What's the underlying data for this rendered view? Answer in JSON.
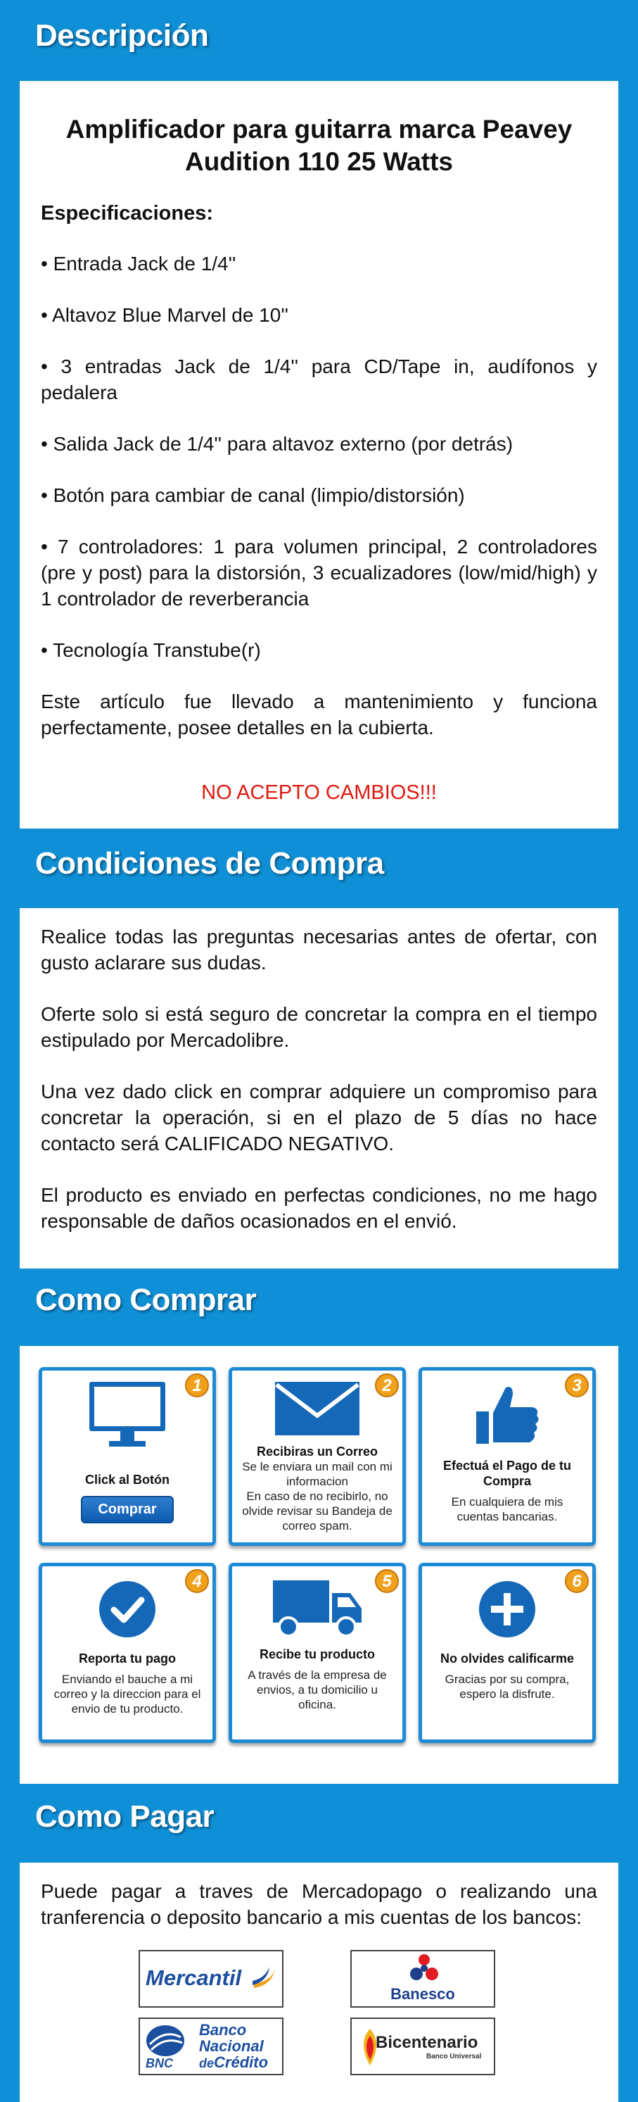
{
  "descripcion": {
    "heading": "Descripción",
    "product_title": "Amplificador para guitarra marca Peavey Audition 110 25 Watts",
    "specs_heading": "Especificaciones:",
    "bullets": [
      "• Entrada Jack de 1/4''",
      "• Altavoz Blue Marvel de 10''",
      "• 3 entradas Jack de 1/4'' para CD/Tape in, audífonos y pedalera",
      "• Salida Jack de 1/4'' para altavoz externo (por detrás)",
      "• Botón para cambiar de canal (limpio/distorsión)",
      "• 7 controladores: 1 para volumen principal, 2 controladores (pre y post) para la distorsión, 3 ecualizadores (low/mid/high) y 1 controlador de reverberancia",
      "• Tecnología Transtube(r)"
    ],
    "note": "Este artículo fue llevado a mantenimiento y funciona perfectamente, posee detalles en la cubierta.",
    "warning": "NO ACEPTO CAMBIOS!!!"
  },
  "condiciones": {
    "heading": "Condiciones de Compra",
    "paragraphs": [
      "Realice todas las preguntas necesarias antes de ofertar, con gusto aclarare sus dudas.",
      "Oferte solo si está seguro de concretar la compra en el tiempo estipulado por Mercadolibre.",
      "Una vez dado click en comprar adquiere un compromiso para concretar la operación, si en el plazo de 5 días no hace contacto será CALIFICADO NEGATIVO.",
      "El producto es enviado en perfectas condiciones, no me hago responsable de daños ocasionados en el envió."
    ]
  },
  "como_comprar": {
    "heading": "Como Comprar",
    "steps": [
      {
        "num": "1",
        "icon": "monitor-icon",
        "title": "Click al Botón",
        "button": "Comprar",
        "desc": ""
      },
      {
        "num": "2",
        "icon": "envelope-icon",
        "title": "Recibiras un Correo",
        "desc": "Se le enviara un mail con mi informacion\nEn caso de no recibirlo, no olvide revisar su Bandeja de correo spam."
      },
      {
        "num": "3",
        "icon": "thumbs-up-icon",
        "title": "Efectuá el Pago de tu Compra",
        "desc": "En cualquiera de mis cuentas bancarias."
      },
      {
        "num": "4",
        "icon": "check-circle-icon",
        "title": "Reporta tu pago",
        "desc": "Enviando el bauche a mi correo y la direccion para el envio de tu producto."
      },
      {
        "num": "5",
        "icon": "truck-icon",
        "title": "Recibe tu producto",
        "desc": "A través de la empresa de envios, a tu domicilio u oficina."
      },
      {
        "num": "6",
        "icon": "plus-circle-icon",
        "title": "No olvides calificarme",
        "desc": "Gracias por su compra, espero la disfrute."
      }
    ]
  },
  "como_pagar": {
    "heading": "Como Pagar",
    "text": "Puede pagar a traves de Mercadopago o realizando una tranferencia o deposito bancario a mis cuentas de los bancos:",
    "banks": {
      "mercantil": "Mercantil",
      "banesco": "Banesco",
      "bnc_line1": "Banco",
      "bnc_line2": "Nacional",
      "bnc_line3": "de",
      "bnc_line4": "Crédito",
      "bnc_short": "BNC",
      "bicentenario": "Bicentenario",
      "bicentenario_sub": "Banco Universal"
    }
  },
  "colors": {
    "background": "#0f8fd6",
    "card_border": "#1d8ad6",
    "icon_blue": "#1568b8",
    "warning": "#e0190f",
    "badge": "#f0a11c"
  }
}
